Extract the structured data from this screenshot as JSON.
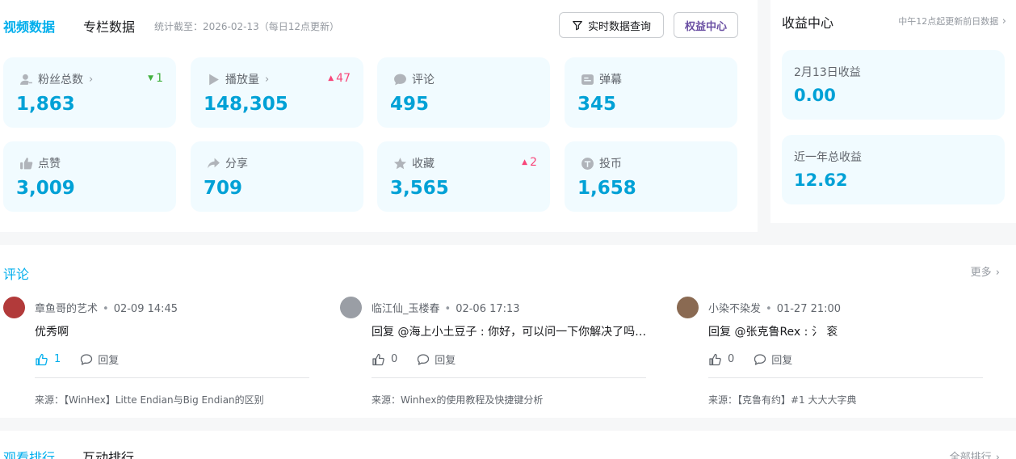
{
  "header": {
    "tab_video": "视频数据",
    "tab_column": "专栏数据",
    "stat_note": "统计截至：2026-02-13（每日12点更新）",
    "btn_realtime": "实时数据查询",
    "btn_benefit": "权益中心"
  },
  "cards": [
    {
      "label": "粉丝总数",
      "value": "1,863",
      "delta": "1",
      "dir": "down",
      "icon": "user-icon",
      "chevron": true
    },
    {
      "label": "播放量",
      "value": "148,305",
      "delta": "47",
      "dir": "up",
      "icon": "play-icon",
      "chevron": true
    },
    {
      "label": "评论",
      "value": "495",
      "delta": "",
      "dir": "",
      "icon": "comment-icon",
      "chevron": false
    },
    {
      "label": "弹幕",
      "value": "345",
      "delta": "",
      "dir": "",
      "icon": "danmaku-icon",
      "chevron": false
    },
    {
      "label": "点赞",
      "value": "3,009",
      "delta": "",
      "dir": "",
      "icon": "thumb-icon",
      "chevron": false
    },
    {
      "label": "分享",
      "value": "709",
      "delta": "",
      "dir": "",
      "icon": "share-icon",
      "chevron": false
    },
    {
      "label": "收藏",
      "value": "3,565",
      "delta": "2",
      "dir": "up",
      "icon": "star-icon",
      "chevron": false
    },
    {
      "label": "投币",
      "value": "1,658",
      "delta": "",
      "dir": "",
      "icon": "coin-icon",
      "chevron": false
    }
  ],
  "income": {
    "title": "收益中心",
    "note": "中午12点起更新前日数据",
    "items": [
      {
        "label": "2月13日收益",
        "value": "0.00"
      },
      {
        "label": "近一年总收益",
        "value": "12.62"
      }
    ]
  },
  "comments_section": {
    "title": "评论",
    "more": "更多",
    "items": [
      {
        "user": "章鱼哥的艺术",
        "time": "02-09 14:45",
        "text": "优秀啊",
        "likes": "1",
        "liked": true,
        "reply": "回复",
        "source": "来源：【WinHex】Litte Endian与Big Endian的区别",
        "avatar_color": "#b23a3a"
      },
      {
        "user": "临江仙_玉楼春",
        "time": "02-06 17:13",
        "text": "回复 @海上小土豆子 : 你好，可以问一下你解决了吗…",
        "likes": "0",
        "liked": false,
        "reply": "回复",
        "source": "来源：Winhex的使用教程及快捷键分析",
        "avatar_color": "#9a9ea5"
      },
      {
        "user": "小染不染发",
        "time": "01-27 21:00",
        "text": "回复 @张克鲁Rex : 氵 衮",
        "likes": "0",
        "liked": false,
        "reply": "回复",
        "source": "来源：【克鲁有约】#1 大大大字典",
        "avatar_color": "#8a6a52"
      }
    ]
  },
  "ranking": {
    "tab_watch": "观看排行",
    "tab_interact": "互动排行",
    "more": "全部排行"
  },
  "colors": {
    "accent": "#00aeec",
    "value": "#00a1d6",
    "up": "#f8467a",
    "down": "#41b03f",
    "card_bg": "#f1fbff"
  }
}
